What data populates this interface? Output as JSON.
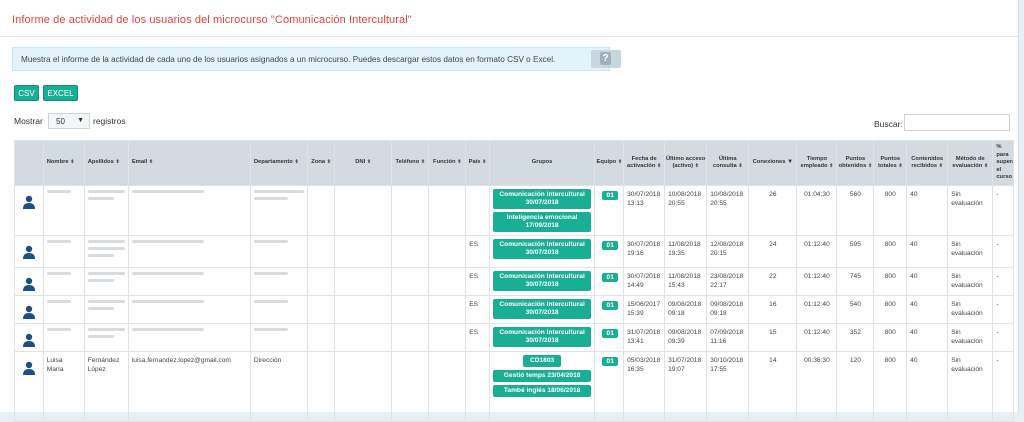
{
  "title": "Informe de actividad de los usuarios del microcurso \"Comunicación Intercultural\"",
  "info": "Muestra el informe de la actividad de cada uno de los usuarios asignados a un microcurso. Puedes descargar estos datos en formato CSV o Excel.",
  "help_glyph": "?",
  "buttons": {
    "csv": "CSV",
    "excel": "EXCEL"
  },
  "length": {
    "prefix": "Mostrar",
    "value": "50",
    "suffix": "registros",
    "arrow": "▼"
  },
  "search_label": "Buscar:",
  "sort_glyph": "⬍",
  "columns": {
    "nombre": "Nombre",
    "apellidos": "Apellidos",
    "email": "Email",
    "departamento": "Departamento",
    "zona": "Zona",
    "dni": "DNI",
    "telefono": "Teléfono",
    "funcion": "Función",
    "pais": "País",
    "grupos": "Grupos",
    "equipo": "Equipo",
    "fecha_activacion": "Fecha de activación",
    "ultimo_acceso": "Último acceso (activo)",
    "ultima_consulta": "Última consulta",
    "conexiones": "Conexiones",
    "tiempo": "Tiempo empleado",
    "puntos_obtenidos": "Puntos obtenidos",
    "puntos_totales": "Puntos totales",
    "contenidos": "Contenidos recibidos",
    "metodo": "Método de evaluación",
    "porcentaje": "% para superar el curso"
  },
  "rows": [
    {
      "pais": "",
      "groups": [
        "Comunicación Intercultural 30/07/2018",
        "Inteligencia emocional 17/09/2018"
      ],
      "team": "01",
      "activacion": "30/07/2018 13:13",
      "acceso": "10/08/2018 20:55",
      "consulta": "10/08/2018 20:55",
      "conexiones": "26",
      "tiempo": "01:04:30",
      "obtenidos": "560",
      "totales": "800",
      "contenidos": "40",
      "metodo": "Sin evaluación",
      "porcentaje": "-"
    },
    {
      "pais": "ES",
      "groups": [
        "Comunicación Intercultural 30/07/2018"
      ],
      "team": "01",
      "activacion": "30/07/2018 19:16",
      "acceso": "11/08/2018 19:35",
      "consulta": "12/08/2018 20:15",
      "conexiones": "24",
      "tiempo": "01:12:40",
      "obtenidos": "595",
      "totales": "800",
      "contenidos": "40",
      "metodo": "Sin evaluación",
      "porcentaje": "-"
    },
    {
      "pais": "ES",
      "groups": [
        "Comunicación Intercultural 30/07/2018"
      ],
      "team": "01",
      "activacion": "30/07/2018 14:49",
      "acceso": "11/08/2018 15:43",
      "consulta": "23/08/2018 22:17",
      "conexiones": "22",
      "tiempo": "01:12:40",
      "obtenidos": "745",
      "totales": "800",
      "contenidos": "40",
      "metodo": "Sin evaluación",
      "porcentaje": "-"
    },
    {
      "pais": "ES",
      "groups": [
        "Comunicación Intercultural 30/07/2018"
      ],
      "team": "01",
      "activacion": "15/06/2017 15:39",
      "acceso": "09/08/2018 09:18",
      "consulta": "09/08/2018 09:18",
      "conexiones": "16",
      "tiempo": "01:12:40",
      "obtenidos": "540",
      "totales": "800",
      "contenidos": "40",
      "metodo": "Sin evaluación",
      "porcentaje": "-"
    },
    {
      "pais": "ES",
      "groups": [
        "Comunicación Intercultural 30/07/2018"
      ],
      "team": "01",
      "activacion": "31/07/2018 13:41",
      "acceso": "09/08/2018 09:39",
      "consulta": "07/09/2018 11:16",
      "conexiones": "15",
      "tiempo": "01:12:40",
      "obtenidos": "352",
      "obtenidos_note": "",
      "totales": "800",
      "contenidos": "40",
      "metodo": "Sin evaluación",
      "porcentaje": "-"
    },
    {
      "pais": "",
      "nombre": "Luisa María",
      "apellidos": "Fernández López",
      "email": "luisa.fernandez.lopez@gmail.com",
      "departamento": "Dirección",
      "groups": [
        "CD1803",
        "Gestió temps 23/04/2018",
        "També inglés 18/06/2018"
      ],
      "team": "01",
      "activacion": "05/03/2018 16:35",
      "acceso": "31/07/2018 19:07",
      "consulta": "30/10/2018 17:55",
      "conexiones": "14",
      "tiempo": "00:36:30",
      "obtenidos": "120",
      "totales": "800",
      "contenidos": "40",
      "metodo": "Sin evaluación",
      "porcentaje": "-"
    }
  ]
}
